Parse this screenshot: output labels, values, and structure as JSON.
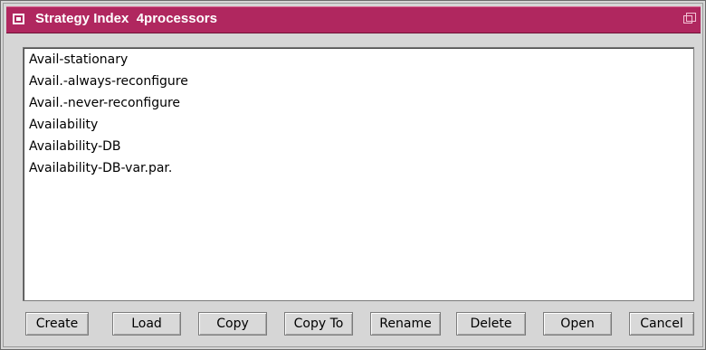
{
  "window": {
    "title": "Strategy Index  4processors"
  },
  "list": {
    "items": [
      "Avail-stationary",
      "Avail.-always-reconfigure",
      "Avail.-never-reconfigure",
      "Availability",
      "Availability-DB",
      "Availability-DB-var.par."
    ]
  },
  "buttons": {
    "create": "Create",
    "load": "Load",
    "copy": "Copy",
    "copy_to": "Copy To",
    "rename": "Rename",
    "delete": "Delete",
    "open": "Open",
    "cancel": "Cancel"
  },
  "colors": {
    "titlebar": "#b0275f",
    "window_bg": "#d6d6d6"
  }
}
